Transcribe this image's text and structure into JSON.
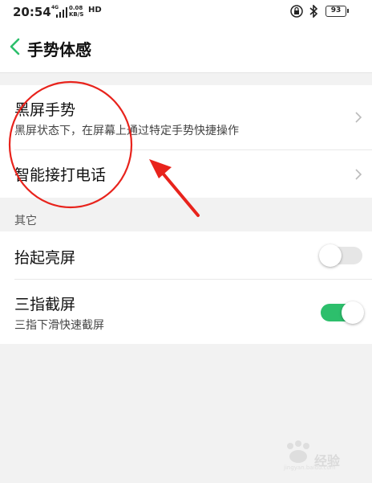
{
  "status_bar": {
    "time": "20:54",
    "network": "4G",
    "speed_value": "0.08",
    "speed_unit": "KB/S",
    "hd": "HD",
    "battery": "93"
  },
  "header": {
    "title": "手势体感"
  },
  "gesture_section": {
    "items": [
      {
        "title": "黑屏手势",
        "subtitle": "黑屏状态下，在屏幕上通过特定手势快捷操作"
      },
      {
        "title": "智能接打电话"
      }
    ]
  },
  "other_section": {
    "label": "其它",
    "items": [
      {
        "title": "抬起亮屏",
        "toggle": "off"
      },
      {
        "title": "三指截屏",
        "subtitle": "三指下滑快速截屏",
        "toggle": "on"
      }
    ]
  },
  "colors": {
    "accent_green": "#2dbf6c",
    "annotation_red": "#e8231c"
  },
  "watermark": {
    "text": "经验",
    "url": "jingyan.baidu.com"
  }
}
